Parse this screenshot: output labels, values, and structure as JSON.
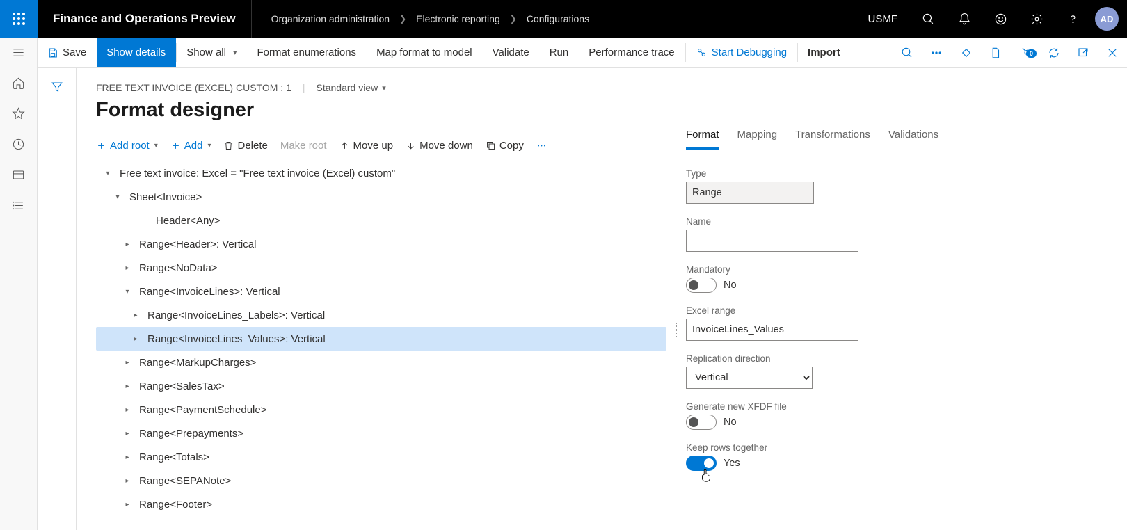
{
  "header": {
    "app_title": "Finance and Operations Preview",
    "breadcrumb": [
      "Organization administration",
      "Electronic reporting",
      "Configurations"
    ],
    "entity": "USMF",
    "avatar": "AD"
  },
  "cmdbar": {
    "save": "Save",
    "show_details": "Show details",
    "show_all": "Show all",
    "format_enum": "Format enumerations",
    "map_format": "Map format to model",
    "validate": "Validate",
    "run": "Run",
    "perf_trace": "Performance trace",
    "start_debug": "Start Debugging",
    "import": "Import",
    "badge_count": "0"
  },
  "page": {
    "context_line": "FREE TEXT INVOICE (EXCEL) CUSTOM : 1",
    "view": "Standard view",
    "title": "Format designer"
  },
  "actions": {
    "add_root": "Add root",
    "add": "Add",
    "delete": "Delete",
    "make_root": "Make root",
    "move_up": "Move up",
    "move_down": "Move down",
    "copy": "Copy"
  },
  "tree": [
    {
      "level": 0,
      "expand": "open",
      "label": "Free text invoice: Excel = \"Free text invoice (Excel) custom\""
    },
    {
      "level": 1,
      "expand": "open",
      "label": "Sheet<Invoice>"
    },
    {
      "level": 2,
      "expand": "none",
      "label": "Header<Any>"
    },
    {
      "level": 3,
      "expand": "closed",
      "label": "Range<Header>: Vertical"
    },
    {
      "level": 3,
      "expand": "closed",
      "label": "Range<NoData>"
    },
    {
      "level": 3,
      "expand": "open",
      "label": "Range<InvoiceLines>: Vertical"
    },
    {
      "level": 4,
      "expand": "closed",
      "label": "Range<InvoiceLines_Labels>: Vertical"
    },
    {
      "level": 4,
      "expand": "closed",
      "label": "Range<InvoiceLines_Values>: Vertical",
      "selected": true
    },
    {
      "level": 3,
      "expand": "closed",
      "label": "Range<MarkupCharges>"
    },
    {
      "level": 3,
      "expand": "closed",
      "label": "Range<SalesTax>"
    },
    {
      "level": 3,
      "expand": "closed",
      "label": "Range<PaymentSchedule>"
    },
    {
      "level": 3,
      "expand": "closed",
      "label": "Range<Prepayments>"
    },
    {
      "level": 3,
      "expand": "closed",
      "label": "Range<Totals>"
    },
    {
      "level": 3,
      "expand": "closed",
      "label": "Range<SEPANote>"
    },
    {
      "level": 3,
      "expand": "closed",
      "label": "Range<Footer>"
    }
  ],
  "tabs": {
    "format": "Format",
    "mapping": "Mapping",
    "transformations": "Transformations",
    "validations": "Validations"
  },
  "props": {
    "type_label": "Type",
    "type_value": "Range",
    "name_label": "Name",
    "name_value": "",
    "mandatory_label": "Mandatory",
    "mandatory_value": "No",
    "excel_range_label": "Excel range",
    "excel_range_value": "InvoiceLines_Values",
    "replication_label": "Replication direction",
    "replication_value": "Vertical",
    "xfdf_label": "Generate new XFDF file",
    "xfdf_value": "No",
    "keep_rows_label": "Keep rows together",
    "keep_rows_value": "Yes"
  }
}
